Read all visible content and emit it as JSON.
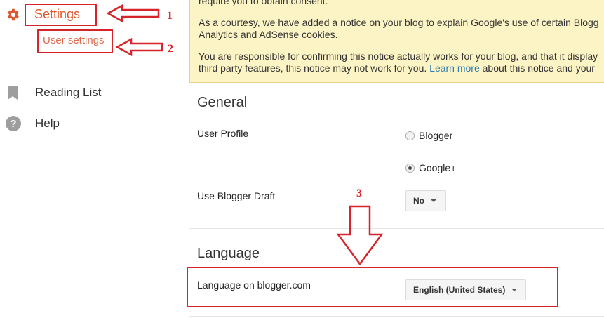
{
  "sidebar": {
    "settings_label": "Settings",
    "user_settings_label": "User settings",
    "items": [
      {
        "label": "Reading List",
        "icon": "bookmark-icon"
      },
      {
        "label": "Help",
        "icon": "help-icon"
      }
    ]
  },
  "notice": {
    "line0": "require you to obtain consent.",
    "line1": "As a courtesy, we have added a notice on your blog to explain Google's use of certain Blogg",
    "line2": "Analytics and AdSense cookies.",
    "line3": "You are responsible for confirming this notice actually works for your blog, and that it display",
    "line4_pre": "third party features, this notice may not work for you. ",
    "line4_link": "Learn more",
    "line4_post": " about this notice and your"
  },
  "general": {
    "title": "General",
    "user_profile_label": "User Profile",
    "radio_blogger": "Blogger",
    "radio_googleplus": "Google+",
    "draft_label": "Use Blogger Draft",
    "draft_value": "No"
  },
  "language": {
    "title": "Language",
    "label": "Language on blogger.com",
    "value": "English (United States)"
  },
  "annotations": {
    "n1": "1",
    "n2": "2",
    "n3": "3"
  },
  "colors": {
    "accent": "#e0562c",
    "annotation_red": "#d6252a",
    "notice_bg": "#fdf4c5"
  }
}
